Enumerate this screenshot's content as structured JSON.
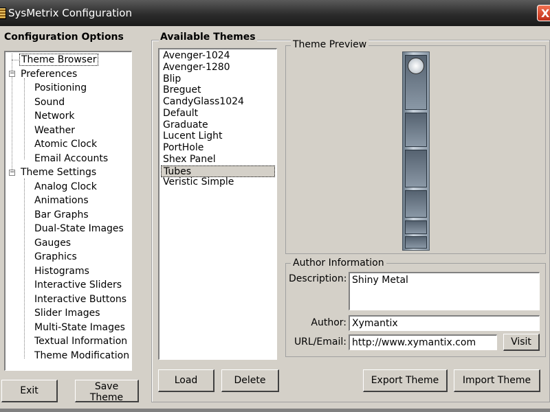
{
  "window": {
    "title": "SysMetrix Configuration",
    "close_glyph": "X"
  },
  "config": {
    "title": "Configuration Options",
    "tree": [
      {
        "label": "Theme Browser"
      },
      {
        "label": "Preferences"
      },
      {
        "label": "Positioning"
      },
      {
        "label": "Sound"
      },
      {
        "label": "Network"
      },
      {
        "label": "Weather"
      },
      {
        "label": "Atomic Clock"
      },
      {
        "label": "Email Accounts"
      },
      {
        "label": "Theme Settings"
      },
      {
        "label": "Analog Clock"
      },
      {
        "label": "Animations"
      },
      {
        "label": "Bar Graphs"
      },
      {
        "label": "Dual-State Images"
      },
      {
        "label": "Gauges"
      },
      {
        "label": "Graphics"
      },
      {
        "label": "Histograms"
      },
      {
        "label": "Interactive Sliders"
      },
      {
        "label": "Interactive Buttons"
      },
      {
        "label": "Slider Images"
      },
      {
        "label": "Multi-State Images"
      },
      {
        "label": "Textual Information"
      },
      {
        "label": "Theme Modification"
      }
    ],
    "exit_label": "Exit",
    "save_label": "Save Theme"
  },
  "themes": {
    "title": "Available Themes",
    "items": [
      "Avenger-1024",
      "Avenger-1280",
      "Blip",
      "Breguet",
      "CandyGlass1024",
      "Default",
      "Graduate",
      "Lucent Light",
      "PortHole",
      "Shex Panel",
      "Tubes",
      "Veristic Simple"
    ],
    "selected": "Tubes",
    "load_label": "Load",
    "delete_label": "Delete"
  },
  "preview": {
    "title": "Theme Preview"
  },
  "author_info": {
    "title": "Author Information",
    "description_label": "Description:",
    "description_value": "Shiny Metal",
    "author_label": "Author:",
    "author_value": "Xymantix",
    "url_label": "URL/Email:",
    "url_value": "http://www.xymantix.com",
    "visit_label": "Visit"
  },
  "actions": {
    "export_label": "Export Theme",
    "import_label": "Import Theme"
  },
  "colors": {
    "titlebar": "#2c2c2c",
    "window_bg": "#d4d0c8",
    "close_button": "#d04020"
  }
}
